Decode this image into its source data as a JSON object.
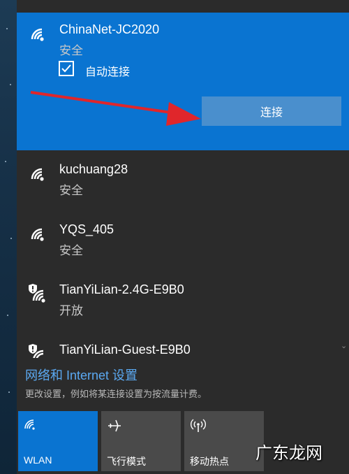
{
  "networks": [
    {
      "name": "ChinaNet-JC2020",
      "status": "安全",
      "icon": "wifi-icon",
      "secured": true
    },
    {
      "name": "kuchuang28",
      "status": "安全",
      "icon": "wifi-icon",
      "secured": true
    },
    {
      "name": "YQS_405",
      "status": "安全",
      "icon": "wifi-icon",
      "secured": true
    },
    {
      "name": "TianYiLian-2.4G-E9B0",
      "status": "开放",
      "icon": "wifi-shield-icon",
      "secured": false
    },
    {
      "name": "TianYiLian-Guest-E9B0",
      "status": "",
      "icon": "wifi-shield-icon",
      "secured": false
    }
  ],
  "selected": {
    "auto_connect_label": "自动连接",
    "auto_connect_checked": true,
    "connect_button": "连接"
  },
  "settings": {
    "link": "网络和 Internet 设置",
    "description": "更改设置，例如将某连接设置为按流量计费。"
  },
  "quick_actions": [
    {
      "label": "WLAN",
      "icon": "wifi-icon",
      "active": true
    },
    {
      "label": "飞行模式",
      "icon": "airplane-icon",
      "active": false
    },
    {
      "label": "移动热点",
      "icon": "hotspot-icon",
      "active": false
    }
  ],
  "watermark": "广东龙网",
  "colors": {
    "accent": "#0a74d1",
    "panel": "#2b2b2b",
    "tile": "#4a4a4a",
    "link": "#5ba9f2",
    "arrow": "#e0262b"
  }
}
